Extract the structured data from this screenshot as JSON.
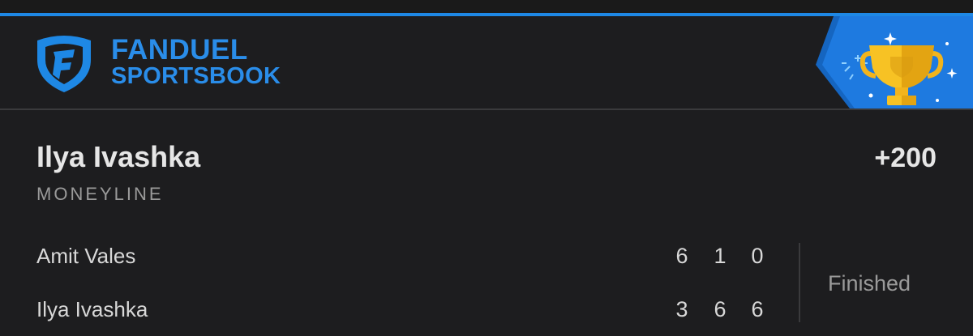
{
  "brand": {
    "name": "FANDUEL",
    "sub": "SPORTSBOOK",
    "accent_color": "#1e88e5",
    "logo_icon": "fanduel-shield-icon",
    "badge_icon": "trophy-icon"
  },
  "bet": {
    "selection": "Ilya Ivashka",
    "market": "MONEYLINE",
    "odds": "+200"
  },
  "match": {
    "players": [
      {
        "name": "Amit Vales",
        "sets": [
          "6",
          "1",
          "0"
        ]
      },
      {
        "name": "Ilya Ivashka",
        "sets": [
          "3",
          "6",
          "6"
        ]
      }
    ],
    "status": "Finished"
  }
}
